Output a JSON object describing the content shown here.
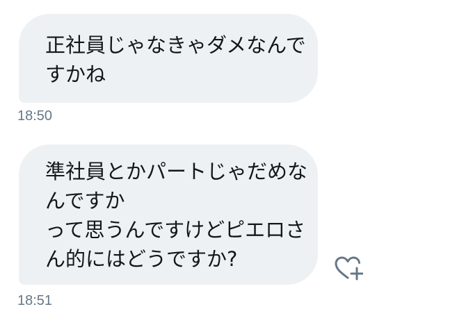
{
  "messages": [
    {
      "lines": [
        "正社員じゃなきゃダメなんで",
        "すかね"
      ],
      "time": "18:50"
    },
    {
      "lines": [
        "準社員とかパートじゃだめな",
        "んですか",
        "って思うんですけどピエロさ",
        "ん的にはどうですか?"
      ],
      "time": "18:51"
    }
  ],
  "icons": {
    "like": "heart-plus-icon"
  },
  "colors": {
    "bubble_bg": "#eef1f3",
    "text": "#14171a",
    "timestamp": "#657786",
    "icon": "#657786"
  }
}
